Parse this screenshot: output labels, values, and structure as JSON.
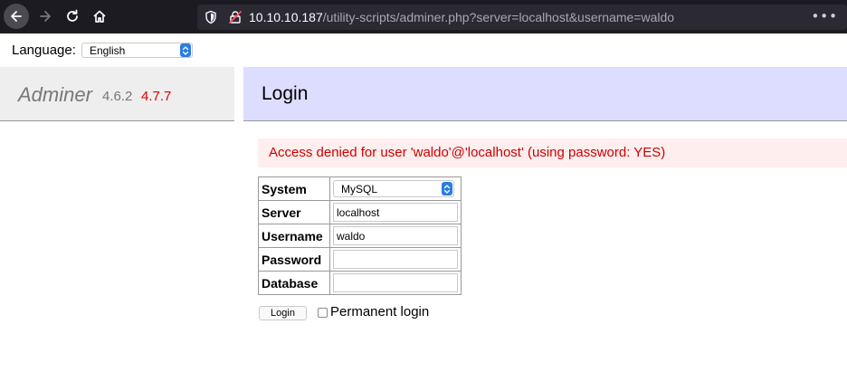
{
  "browser": {
    "url_host": "10.10.10.187",
    "url_path": "/utility-scripts/adminer.php?server=localhost&username=waldo",
    "menu_icon": "•••"
  },
  "language": {
    "label": "Language:",
    "selected": "English"
  },
  "brand": {
    "name": "Adminer",
    "version": "4.6.2",
    "new_version": "4.7.7"
  },
  "page": {
    "title": "Login"
  },
  "error": {
    "message": "Access denied for user 'waldo'@'localhost' (using password: YES)"
  },
  "form": {
    "rows": [
      {
        "label": "System",
        "value": "MySQL"
      },
      {
        "label": "Server",
        "value": "localhost"
      },
      {
        "label": "Username",
        "value": "waldo"
      },
      {
        "label": "Password",
        "value": ""
      },
      {
        "label": "Database",
        "value": ""
      }
    ],
    "login_label": "Login",
    "permanent_label": "Permanent login"
  },
  "colors": {
    "toolbar": "#1c1b22",
    "content_header": "#ddddff",
    "error_bg": "#ffeeee",
    "error_text": "#cc0000",
    "new_version": "#e00000"
  }
}
